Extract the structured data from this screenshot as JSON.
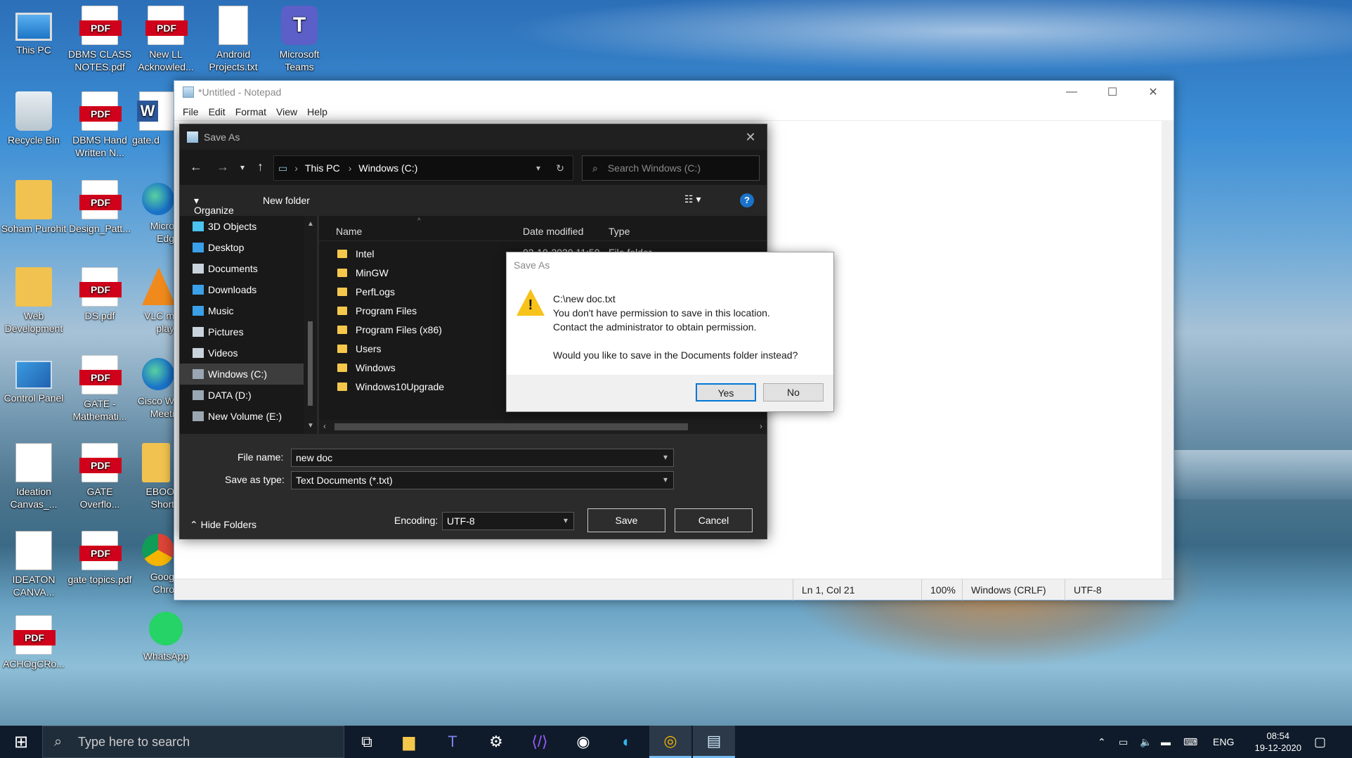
{
  "desktop": {
    "icons": [
      {
        "label": "This PC"
      },
      {
        "label": "DBMS CLASS NOTES.pdf"
      },
      {
        "label": "New LL Acknowled..."
      },
      {
        "label": "Android Projects.txt"
      },
      {
        "label": "Microsoft Teams"
      },
      {
        "label": "Recycle Bin"
      },
      {
        "label": "DBMS Hand Written N..."
      },
      {
        "label": "gate.d"
      },
      {
        "label": "Soham Purohit"
      },
      {
        "label": "Design_Patt..."
      },
      {
        "label": "Micro Edg"
      },
      {
        "label": "Web Development"
      },
      {
        "label": "DS.pdf"
      },
      {
        "label": "VLC m play"
      },
      {
        "label": "Control Panel"
      },
      {
        "label": "GATE - Mathemati..."
      },
      {
        "label": "Cisco W Meeti"
      },
      {
        "label": "Ideation Canvas_..."
      },
      {
        "label": "GATE Overflo..."
      },
      {
        "label": "EBOO Short"
      },
      {
        "label": "IDEATON CANVA..."
      },
      {
        "label": "gate topics.pdf"
      },
      {
        "label": "Goog Chro"
      },
      {
        "label": "ACHOgCRo..."
      },
      {
        "label": "WhatsApp"
      }
    ]
  },
  "notepad": {
    "title": "*Untitled - Notepad",
    "menu": [
      "File",
      "Edit",
      "Format",
      "View",
      "Help"
    ],
    "status": {
      "position": "Ln 1, Col 21",
      "zoom": "100%",
      "line_ending": "Windows (CRLF)",
      "encoding": "UTF-8"
    }
  },
  "save_dialog": {
    "title": "Save As",
    "breadcrumb": [
      "This PC",
      "Windows (C:)"
    ],
    "search_placeholder": "Search Windows (C:)",
    "organize_label": "Organize",
    "new_folder_label": "New folder",
    "tree": [
      {
        "label": "3D Objects",
        "icon": "cube-icon"
      },
      {
        "label": "Desktop",
        "icon": "desktop-icon"
      },
      {
        "label": "Documents",
        "icon": "documents-icon"
      },
      {
        "label": "Downloads",
        "icon": "download-icon"
      },
      {
        "label": "Music",
        "icon": "music-icon"
      },
      {
        "label": "Pictures",
        "icon": "pictures-icon"
      },
      {
        "label": "Videos",
        "icon": "videos-icon"
      },
      {
        "label": "Windows (C:)",
        "icon": "drive-icon",
        "selected": true
      },
      {
        "label": "DATA (D:)",
        "icon": "drive-icon"
      },
      {
        "label": "New Volume (E:)",
        "icon": "drive-icon"
      }
    ],
    "columns": {
      "name": "Name",
      "date": "Date modified",
      "type": "Type"
    },
    "first_row": {
      "date": "02-10-2020 11:50",
      "type": "File folder"
    },
    "files": [
      "Intel",
      "MinGW",
      "PerfLogs",
      "Program Files",
      "Program Files (x86)",
      "Users",
      "Windows",
      "Windows10Upgrade"
    ],
    "file_name_label": "File name:",
    "file_name_value": "new doc",
    "save_type_label": "Save as type:",
    "save_type_value": "Text Documents (*.txt)",
    "hide_folders_label": "Hide Folders",
    "encoding_label": "Encoding:",
    "encoding_value": "UTF-8",
    "save_label": "Save",
    "cancel_label": "Cancel"
  },
  "alert": {
    "title": "Save As",
    "path": "C:\\new doc.txt",
    "line1": "You don't have permission to save in this location.",
    "line2": "Contact the administrator to obtain permission.",
    "question": "Would you like to save in the Documents folder instead?",
    "yes_label": "Yes",
    "no_label": "No"
  },
  "taskbar": {
    "search_placeholder": "Type here to search",
    "language": "ENG",
    "time": "08:54",
    "date": "19-12-2020"
  }
}
